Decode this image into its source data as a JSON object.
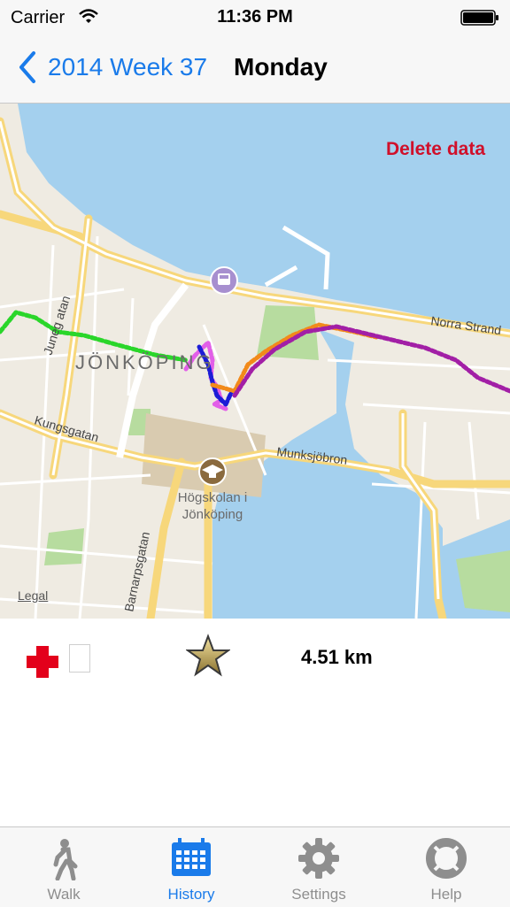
{
  "status_bar": {
    "carrier": "Carrier",
    "time": "11:36 PM"
  },
  "nav": {
    "back_label": "2014 Week 37",
    "title": "Monday"
  },
  "map": {
    "delete_label": "Delete data",
    "legal_label": "Legal",
    "city_label": "JÖNKÖPING",
    "streets": [
      "Juneg atan",
      "Kungsgatan",
      "Munksjöbron",
      "Norra Strand",
      "Barnarpsgatan"
    ],
    "poi_label_line1": "Högskolan i",
    "poi_label_line2": "Jönköping"
  },
  "info": {
    "distance": "4.51  km"
  },
  "tabs": [
    {
      "label": "Walk",
      "icon": "walk-icon"
    },
    {
      "label": "History",
      "icon": "calendar-icon",
      "active": true
    },
    {
      "label": "Settings",
      "icon": "gear-icon"
    },
    {
      "label": "Help",
      "icon": "lifebuoy-icon"
    }
  ],
  "colors": {
    "accent": "#1a7bea",
    "delete": "#d0102a",
    "water": "#a4d0ee"
  }
}
